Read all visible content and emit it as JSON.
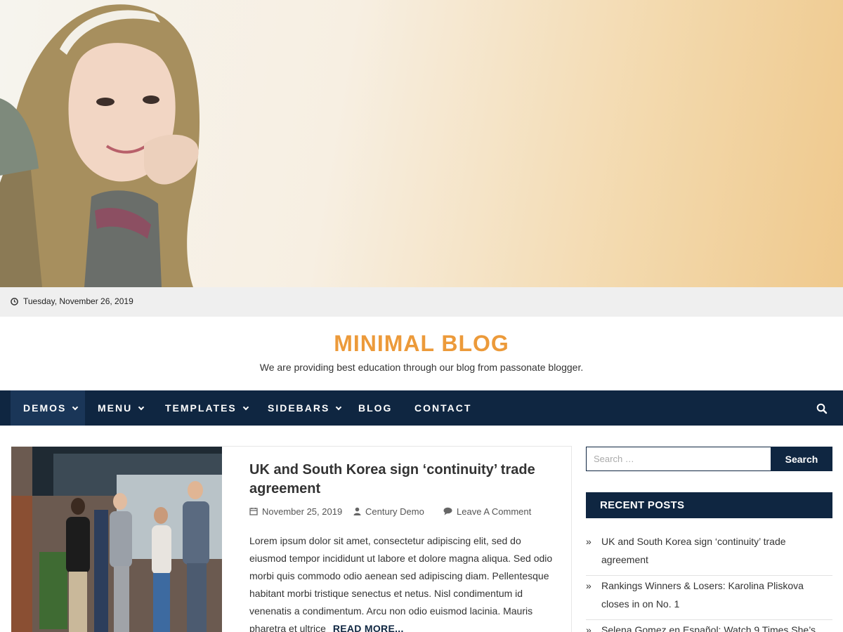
{
  "topbar": {
    "date": "Tuesday, November 26, 2019"
  },
  "site": {
    "title": "MINIMAL BLOG",
    "description": "We are providing best education through our blog from passonate blogger."
  },
  "nav": {
    "items": [
      {
        "label": "DEMOS",
        "has_submenu": true,
        "active": true
      },
      {
        "label": "MENU",
        "has_submenu": true
      },
      {
        "label": "TEMPLATES",
        "has_submenu": true
      },
      {
        "label": "SIDEBARS",
        "has_submenu": true
      },
      {
        "label": "BLOG",
        "has_submenu": false
      },
      {
        "label": "CONTACT",
        "has_submenu": false
      }
    ],
    "search_icon": "search-icon"
  },
  "post": {
    "title": "UK and South Korea sign ‘continuity’ trade agreement",
    "date": "November 25, 2019",
    "author": "Century Demo",
    "comments": "Leave A Comment",
    "excerpt": "Lorem ipsum dolor sit amet, consectetur adipiscing elit, sed do eiusmod tempor incididunt ut labore et dolore magna aliqua. Sed odio morbi quis commodo odio aenean sed adipiscing diam. Pellentesque habitant morbi tristique senectus et netus. Nisl condimentum id venenatis a condimentum. Arcu non odio euismod lacinia. Mauris pharetra et ultrice",
    "read_more": "READ MORE..."
  },
  "sidebar": {
    "search_placeholder": "Search …",
    "search_button": "Search",
    "recent_posts_title": "RECENT POSTS",
    "recent_posts": [
      "UK and South Korea sign ‘continuity’ trade agreement",
      "Rankings Winners & Losers: Karolina Pliskova closes in on No. 1",
      "Selena Gomez en Español: Watch 9 Times She’s"
    ]
  },
  "colors": {
    "navy": "#0f2641",
    "accent": "#ec9a3a",
    "topbar_bg": "#efefef"
  }
}
